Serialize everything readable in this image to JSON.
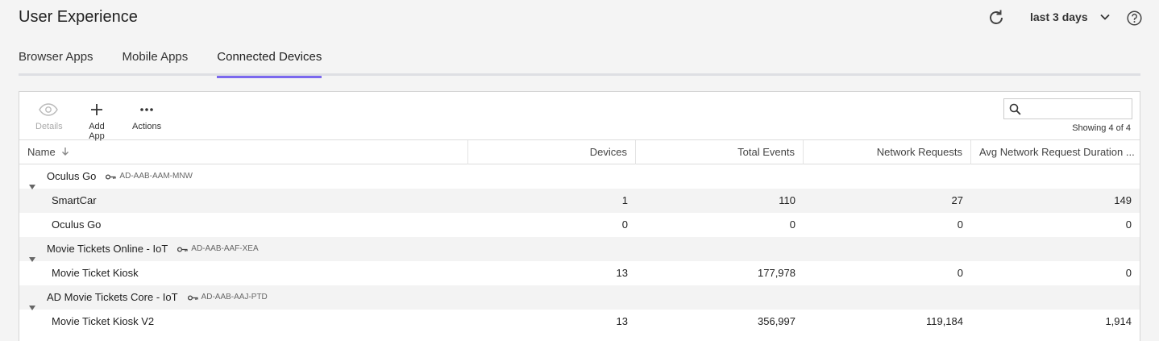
{
  "header": {
    "title": "User Experience",
    "time_range": "last 3 days",
    "icons": {
      "refresh": "refresh-icon",
      "dropdown": "chevron-down-icon",
      "help": "help-icon"
    }
  },
  "tabs": [
    {
      "label": "Browser Apps",
      "active": false
    },
    {
      "label": "Mobile Apps",
      "active": false
    },
    {
      "label": "Connected Devices",
      "active": true
    }
  ],
  "toolbar": {
    "details_label": "Details",
    "add_app_label": "Add App",
    "actions_label": "Actions",
    "search_placeholder": "",
    "showing": "Showing 4 of 4"
  },
  "table": {
    "columns": [
      "Name",
      "Devices",
      "Total Events",
      "Network Requests",
      "Avg Network Request Duration ..."
    ],
    "groups": [
      {
        "name": "Oculus Go",
        "key": "AD-AAB-AAM-MNW",
        "rows": [
          {
            "name": "SmartCar",
            "devices": "1",
            "events": "110",
            "requests": "27",
            "avg": "149"
          },
          {
            "name": "Oculus Go",
            "devices": "0",
            "events": "0",
            "requests": "0",
            "avg": "0"
          }
        ]
      },
      {
        "name": "Movie Tickets Online - IoT",
        "key": "AD-AAB-AAF-XEA",
        "rows": [
          {
            "name": "Movie Ticket Kiosk",
            "devices": "13",
            "events": "177,978",
            "requests": "0",
            "avg": "0"
          }
        ]
      },
      {
        "name": "AD Movie Tickets Core - IoT",
        "key": "AD-AAB-AAJ-PTD",
        "rows": [
          {
            "name": "Movie Ticket Kiosk V2",
            "devices": "13",
            "events": "356,997",
            "requests": "119,184",
            "avg": "1,914"
          }
        ]
      }
    ]
  }
}
